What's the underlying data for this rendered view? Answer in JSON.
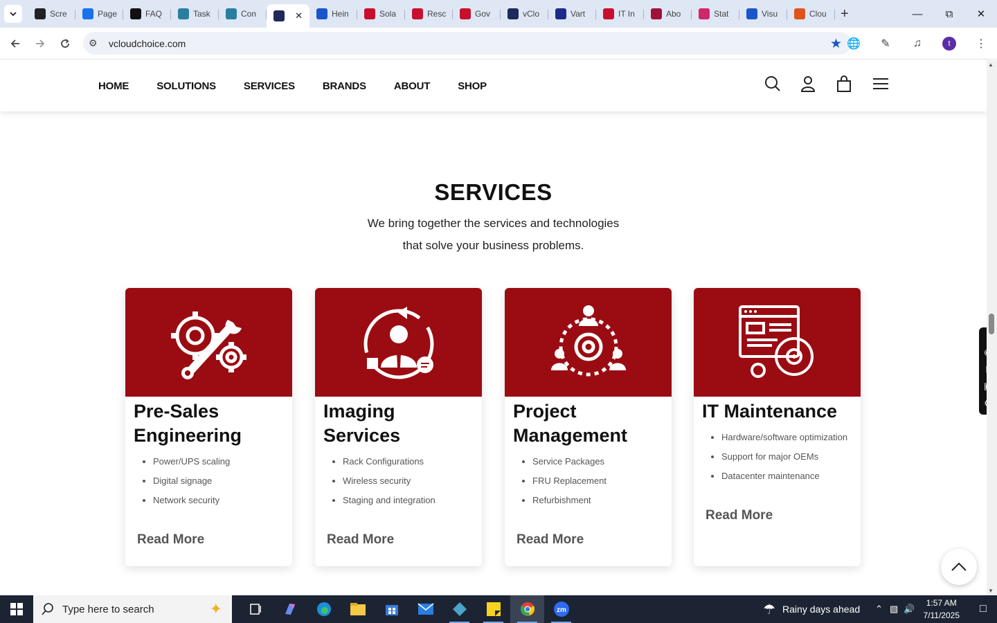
{
  "browser": {
    "tabs": [
      {
        "label": "Scre",
        "color": "#222222"
      },
      {
        "label": "Page",
        "color": "#1a73e8"
      },
      {
        "label": "FAQ",
        "color": "#111111"
      },
      {
        "label": "Task",
        "color": "#2a7fa0"
      },
      {
        "label": "Con",
        "color": "#2a7fa0"
      },
      {
        "label": "",
        "color": "#1d2a5a",
        "active": true
      },
      {
        "label": "Hein",
        "color": "#1a56c9"
      },
      {
        "label": "Sola",
        "color": "#c8102e"
      },
      {
        "label": "Resc",
        "color": "#c8102e"
      },
      {
        "label": "Gov",
        "color": "#c8102e"
      },
      {
        "label": "vClo",
        "color": "#1d2a5a"
      },
      {
        "label": "Vart",
        "color": "#1d2a8a"
      },
      {
        "label": "IT In",
        "color": "#c8102e"
      },
      {
        "label": "Abo",
        "color": "#a0123a"
      },
      {
        "label": "Stat",
        "color": "#d0266a"
      },
      {
        "label": "Visu",
        "color": "#1a56c9"
      },
      {
        "label": "Clou",
        "color": "#e0541c"
      }
    ],
    "active_tab_close": "✕",
    "new_tab": "+",
    "url": "vcloudchoice.com",
    "profile_initial": "t"
  },
  "site": {
    "nav": [
      "HOME",
      "SOLUTIONS",
      "SERVICES",
      "BRANDS",
      "ABOUT",
      "SHOP"
    ],
    "section_title": "SERVICES",
    "section_sub_1": "We bring together the services and technologies",
    "section_sub_2": "that solve your business problems.",
    "accent": "#9a0c12",
    "cards": [
      {
        "title": "Pre-Sales Engineering",
        "items": [
          "Power/UPS scaling",
          "Digital signage",
          "Network security"
        ],
        "more": "Read More",
        "icon": "gear-wrench-icon"
      },
      {
        "title": "Imaging Services",
        "items": [
          "Rack Configurations",
          "Wireless security",
          "Staging and integration"
        ],
        "more": "Read More",
        "icon": "consultant-icon"
      },
      {
        "title": "Project Management",
        "items": [
          "Service Packages",
          "FRU Replacement",
          "Refurbishment"
        ],
        "more": "Read More",
        "icon": "team-gear-icon"
      },
      {
        "title": "IT Maintenance",
        "items": [
          "Hardware/software optimization",
          "Support for major OEMs",
          "Datacenter maintenance"
        ],
        "more": "Read More",
        "icon": "browser-gear-icon"
      }
    ]
  },
  "taskbar": {
    "search_placeholder": "Type here to search",
    "weather": "Rainy days ahead",
    "time": "1:57 AM",
    "date": "7/11/2025"
  }
}
